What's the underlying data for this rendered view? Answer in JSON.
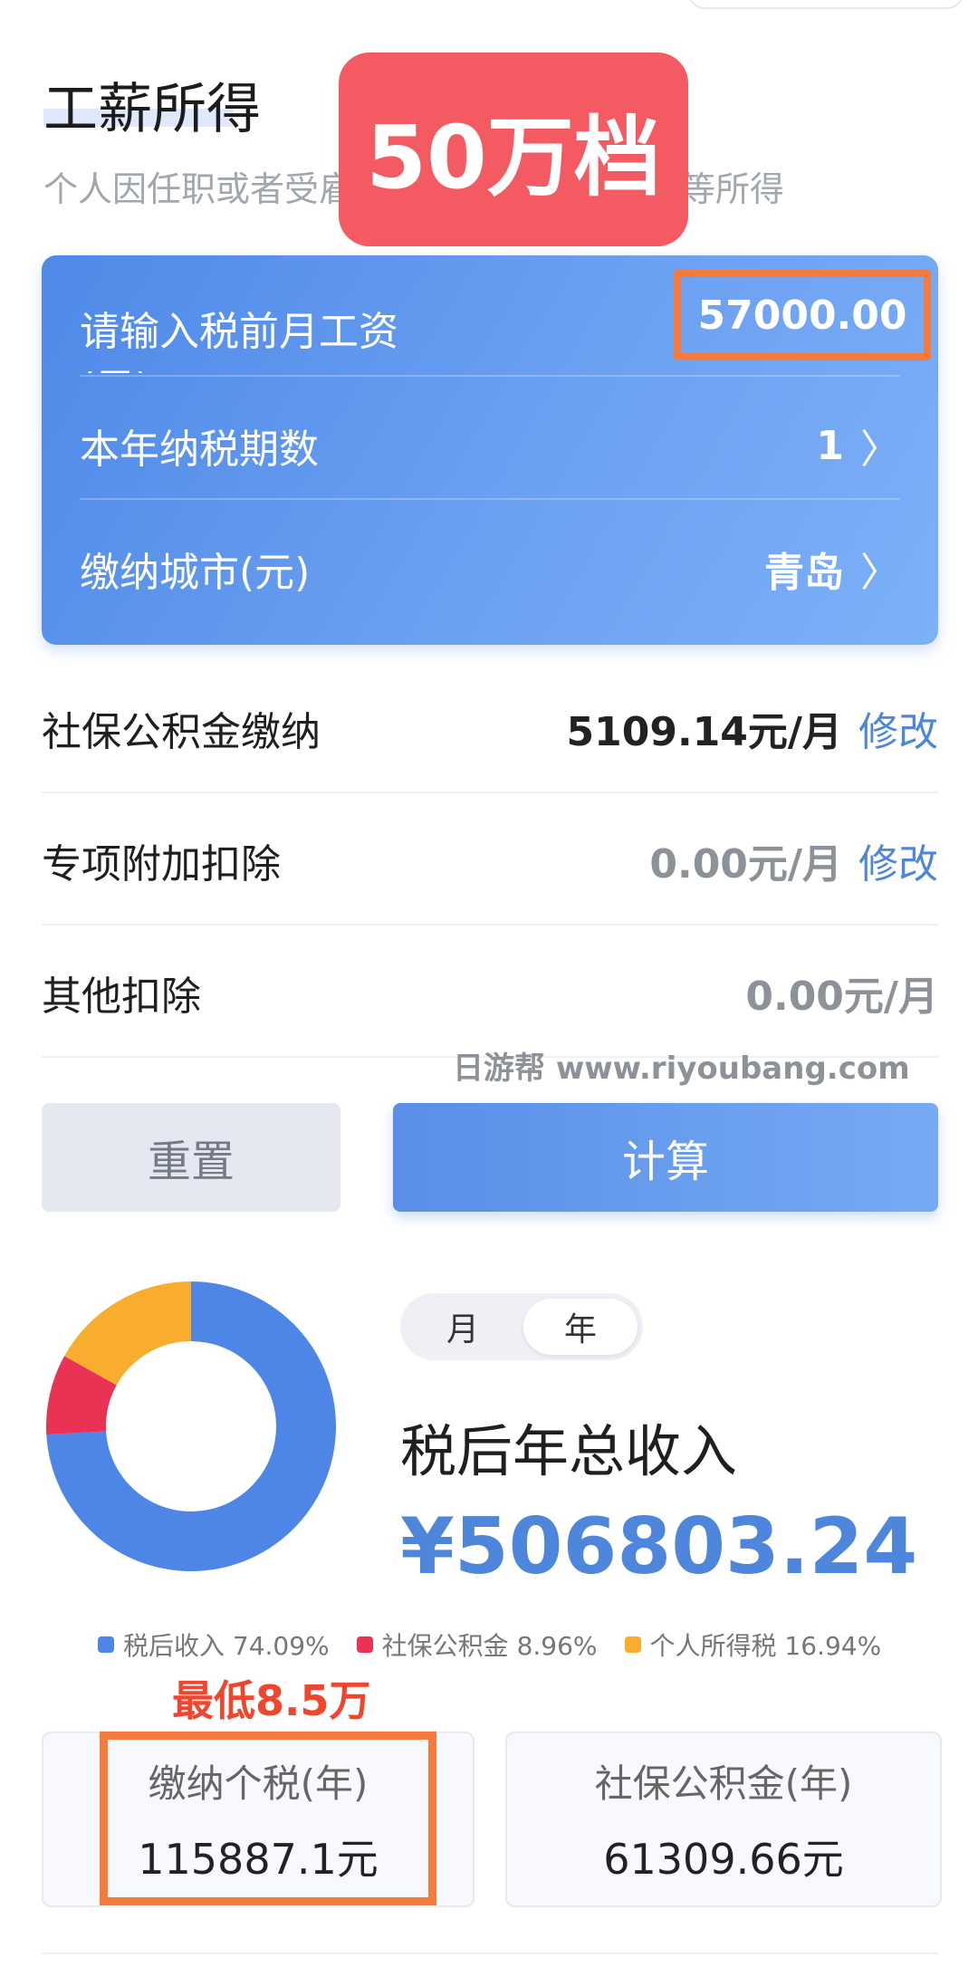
{
  "header": {
    "title": "工薪所得",
    "subtitle": "个人因任职或者受雇",
    "subtitle_tail": "等所得"
  },
  "promo_badge": "50万档",
  "input_card": {
    "salary_label": "请输入税前月工资",
    "salary_label_clip": "(元)",
    "salary_value": "57000.00",
    "periods_label": "本年纳税期数",
    "periods_value": "1",
    "city_label": "缴纳城市(元)",
    "city_value": "青岛"
  },
  "deductions": [
    {
      "label": "社保公积金缴纳",
      "value": "5109.14元/月",
      "action": "修改"
    },
    {
      "label": "专项附加扣除",
      "value": "0.00元/月",
      "action": "修改"
    },
    {
      "label": "其他扣除",
      "value": "0.00元/月"
    }
  ],
  "watermark": "日游帮 www.riyoubang.com",
  "buttons": {
    "reset": "重置",
    "calculate": "计算"
  },
  "result": {
    "toggle": [
      "月",
      "年"
    ],
    "toggle_active": "年",
    "label": "税后年总收入",
    "value": "¥506803.24"
  },
  "chart_data": {
    "type": "pie",
    "donut": true,
    "categories": [
      "税后收入",
      "社保公积金",
      "个人所得税"
    ],
    "values": [
      74.09,
      8.96,
      16.94
    ],
    "labels": [
      "税后收入 74.09%",
      "社保公积金 8.96%",
      "个人所得税 16.94%"
    ],
    "colors": [
      "#4e86e8",
      "#ea3354",
      "#f8ad2f"
    ],
    "legend_position": "bottom"
  },
  "annotation": "最低8.5万",
  "summary_cards": [
    {
      "label": "缴纳个税(年)",
      "value": "115887.1元"
    },
    {
      "label": "社保公积金(年)",
      "value": "61309.66元"
    }
  ]
}
